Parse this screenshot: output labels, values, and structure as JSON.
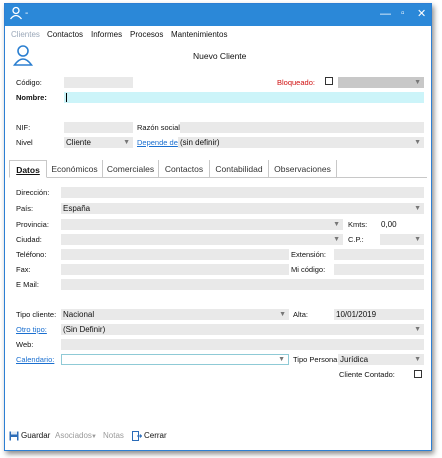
{
  "window": {
    "title": "-"
  },
  "menu": {
    "items": [
      "Clientes",
      "Contactos",
      "Informes",
      "Procesos",
      "Mantenimientos"
    ]
  },
  "header": {
    "title": "Nuevo Cliente"
  },
  "form": {
    "codigo_label": "Código:",
    "bloqueado_label": "Bloqueado:",
    "nombre_label": "Nombre:",
    "nif_label": "NIF:",
    "razon_label": "Razón social:",
    "nivel_label": "Nivel",
    "nivel_value": "Cliente",
    "depende_label": "Depende de",
    "depende_value": "(sin definir)"
  },
  "tabs": [
    "Datos",
    "Económicos",
    "Comerciales",
    "Contactos",
    "Contabilidad",
    "Observaciones"
  ],
  "datos": {
    "direccion_label": "Dirección:",
    "pais_label": "País:",
    "pais_value": "España",
    "provincia_label": "Provincia:",
    "kmts_label": "Kmts:",
    "kmts_value": "0,00",
    "ciudad_label": "Ciudad:",
    "cp_label": "C.P.:",
    "telefono_label": "Teléfono:",
    "extension_label": "Extensión:",
    "fax_label": "Fax:",
    "micodigo_label": "Mi código:",
    "email_label": "E Mail:",
    "tipo_cliente_label": "Tipo cliente:",
    "tipo_cliente_value": "Nacional",
    "alta_label": "Alta:",
    "alta_value": "10/01/2019",
    "otro_tipo_label": "Otro tipo:",
    "otro_tipo_value": "(Sin Definir)",
    "web_label": "Web:",
    "calendario_label": "Calendario:",
    "tipo_persona_label": "Tipo Persona:",
    "tipo_persona_value": "Jurídica",
    "cliente_contado_label": "Cliente Contado:"
  },
  "toolbar": {
    "guardar": "Guardar",
    "asociados": "Asociados",
    "notas": "Notas",
    "cerrar": "Cerrar"
  }
}
